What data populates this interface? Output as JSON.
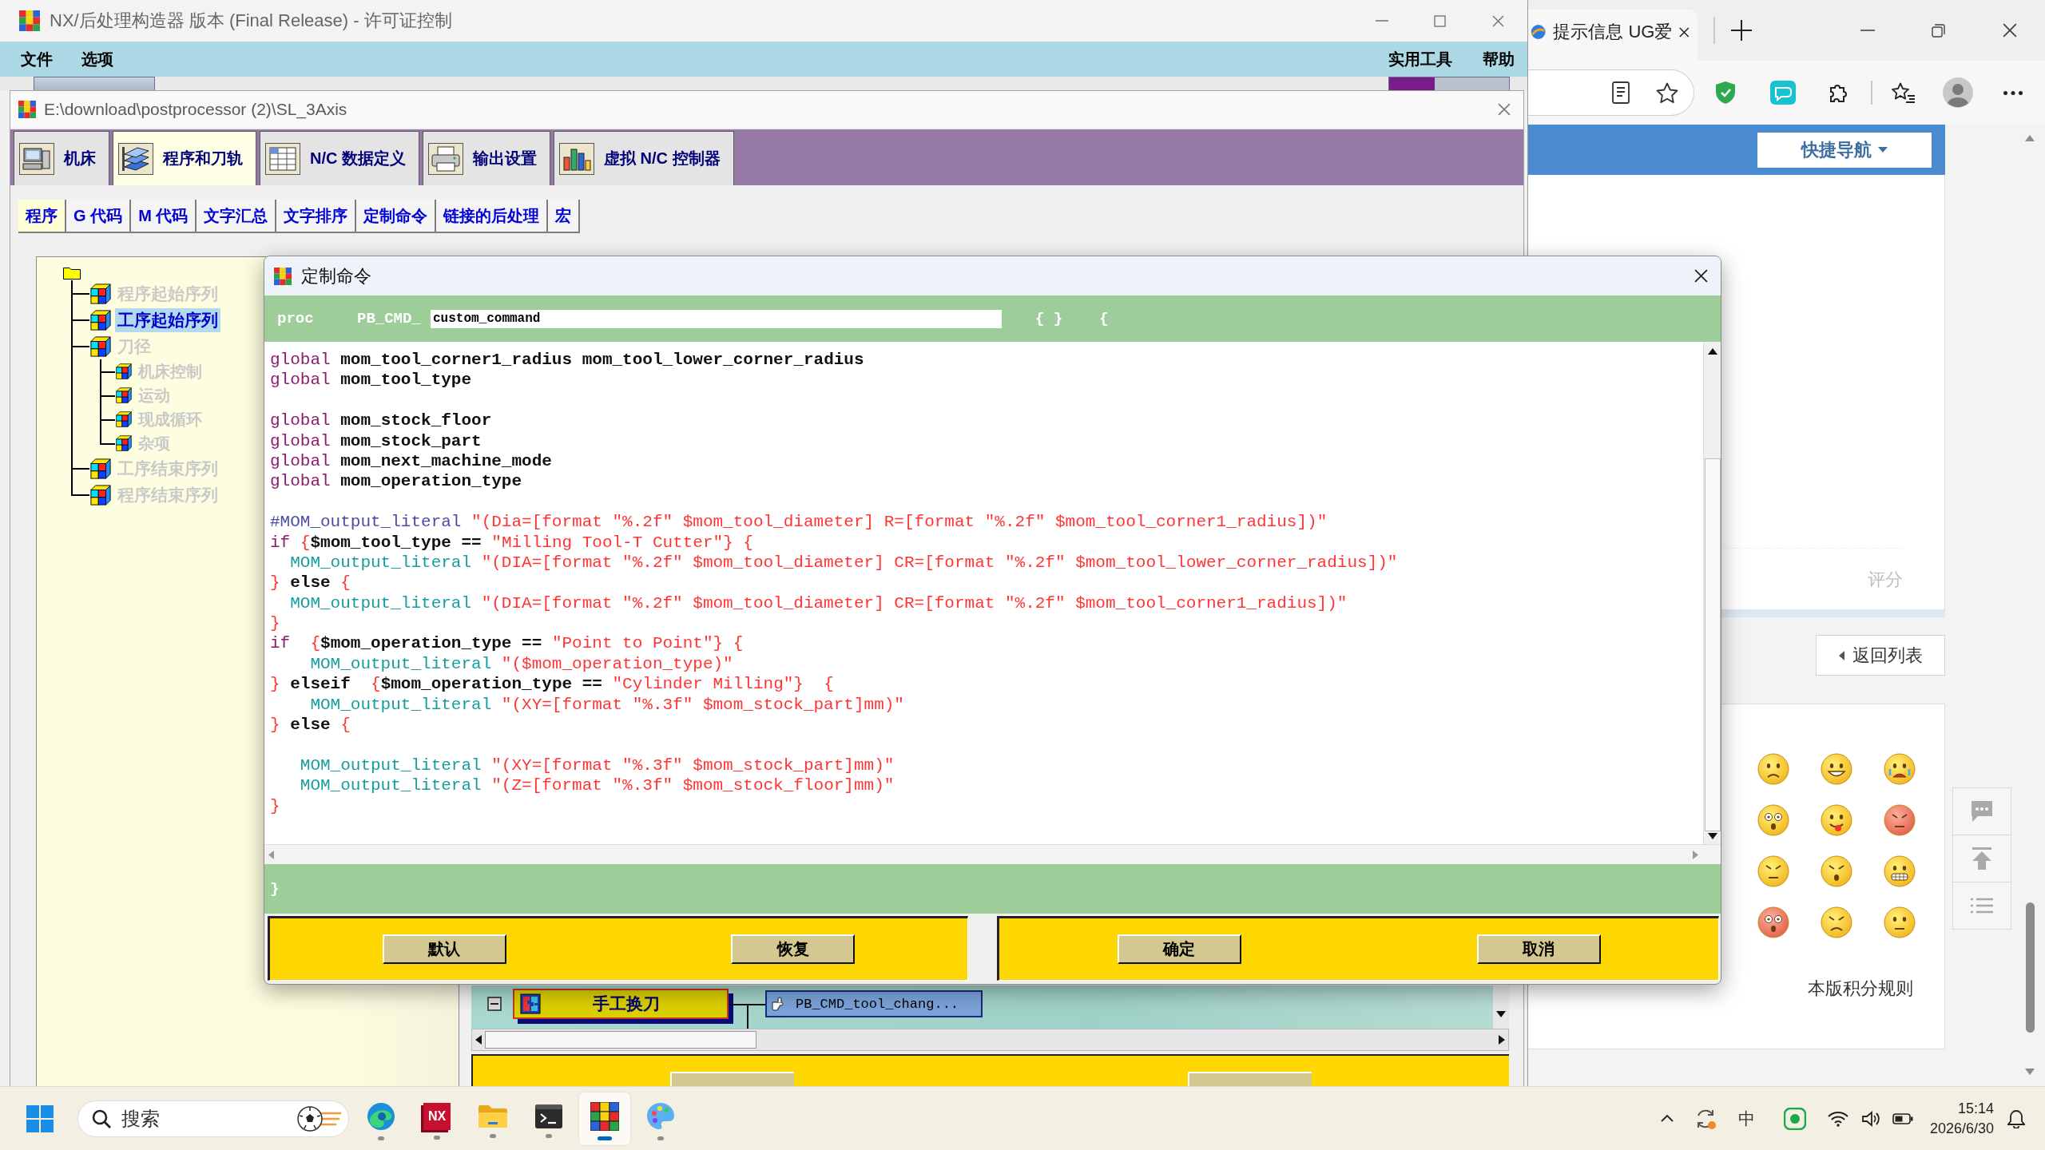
{
  "nx_window": {
    "title": "NX/后处理构造器 版本 (Final Release) - 许可证控制",
    "menu_left": [
      "文件",
      "选项"
    ],
    "menu_right": [
      "实用工具",
      "帮助"
    ]
  },
  "post_window": {
    "title": "E:\\download\\postprocessor (2)\\SL_3Axis",
    "tabs": [
      {
        "label": "机床",
        "kind": "machine",
        "selected": false
      },
      {
        "label": "程序和刀轨",
        "kind": "program",
        "selected": true
      },
      {
        "label": "N/C 数据定义",
        "kind": "data",
        "selected": false
      },
      {
        "label": "输出设置",
        "kind": "output",
        "selected": false
      },
      {
        "label": "虚拟 N/C 控制器",
        "kind": "controller",
        "selected": false
      }
    ],
    "subtabs": [
      {
        "label": "程序",
        "selected": true
      },
      {
        "label": "G 代码",
        "selected": false
      },
      {
        "label": "M 代码",
        "selected": false
      },
      {
        "label": "文字汇总",
        "selected": false
      },
      {
        "label": "文字排序",
        "selected": false
      },
      {
        "label": "定制命令",
        "selected": false
      },
      {
        "label": "链接的后处理",
        "selected": false
      },
      {
        "label": "宏",
        "selected": false
      }
    ],
    "tree": {
      "children": [
        {
          "label": "程序起始序列",
          "selected": false
        },
        {
          "label": "工序起始序列",
          "selected": true
        },
        {
          "label": "刀径",
          "selected": false,
          "children": [
            {
              "label": "机床控制",
              "selected": false
            },
            {
              "label": "运动",
              "selected": false
            },
            {
              "label": "现成循环",
              "selected": false
            },
            {
              "label": "杂项",
              "selected": false
            }
          ]
        },
        {
          "label": "工序结束序列",
          "selected": false
        },
        {
          "label": "程序结束序列",
          "selected": false
        }
      ]
    },
    "sequence": {
      "event": "手工换刀",
      "command": "PB_CMD_tool_chang..."
    }
  },
  "dialog": {
    "title": "定制命令",
    "header": {
      "keyword": "proc",
      "prefix": "PB_CMD_",
      "name_value": "custom_command",
      "args": "{ }",
      "brace": "{"
    },
    "code_lines": [
      {
        "kind": "code",
        "tokens": [
          {
            "kind": "keyword",
            "text": "global"
          },
          {
            "kind": "plain",
            "text": " mom_tool_corner1_radius mom_tool_lower_corner_radius"
          }
        ]
      },
      {
        "kind": "code",
        "tokens": [
          {
            "kind": "keyword",
            "text": "global"
          },
          {
            "kind": "plain",
            "text": " mom_tool_type"
          }
        ]
      },
      {
        "kind": "blank"
      },
      {
        "kind": "code",
        "tokens": [
          {
            "kind": "keyword",
            "text": "global"
          },
          {
            "kind": "plain",
            "text": " mom_stock_floor"
          }
        ]
      },
      {
        "kind": "code",
        "tokens": [
          {
            "kind": "keyword",
            "text": "global"
          },
          {
            "kind": "plain",
            "text": " mom_stock_part"
          }
        ]
      },
      {
        "kind": "code",
        "tokens": [
          {
            "kind": "keyword",
            "text": "global"
          },
          {
            "kind": "plain",
            "text": " mom_next_machine_mode"
          }
        ]
      },
      {
        "kind": "code",
        "tokens": [
          {
            "kind": "keyword",
            "text": "global"
          },
          {
            "kind": "plain",
            "text": " mom_operation_type"
          }
        ]
      },
      {
        "kind": "blank"
      },
      {
        "kind": "code",
        "tokens": [
          {
            "kind": "comment",
            "text": "#MOM_output_literal"
          },
          {
            "kind": "string",
            "text": " \"(Dia=[format \"%.2f\" $mom_tool_diameter] R=[format \"%.2f\" $mom_tool_corner1_radius])\""
          }
        ]
      },
      {
        "kind": "code",
        "tokens": [
          {
            "kind": "keyword",
            "text": "if"
          },
          {
            "kind": "brace",
            "text": " {"
          },
          {
            "kind": "plain",
            "text": "$mom_tool_type =="
          },
          {
            "kind": "string",
            "text": " \"Milling Tool-T Cutter\""
          },
          {
            "kind": "brace",
            "text": "} {"
          }
        ]
      },
      {
        "kind": "code",
        "tokens": [
          {
            "kind": "command",
            "text": "  MOM_output_literal"
          },
          {
            "kind": "string",
            "text": " \"(DIA=[format \"%.2f\" $mom_tool_diameter] CR=[format \"%.2f\" $mom_tool_lower_corner_radius])\""
          }
        ]
      },
      {
        "kind": "code",
        "tokens": [
          {
            "kind": "brace",
            "text": "}"
          },
          {
            "kind": "plain",
            "text": " else"
          },
          {
            "kind": "brace",
            "text": " {"
          }
        ]
      },
      {
        "kind": "code",
        "tokens": [
          {
            "kind": "command",
            "text": "  MOM_output_literal"
          },
          {
            "kind": "string",
            "text": " \"(DIA=[format \"%.2f\" $mom_tool_diameter] CR=[format \"%.2f\" $mom_tool_corner1_radius])\""
          }
        ]
      },
      {
        "kind": "code",
        "tokens": [
          {
            "kind": "brace",
            "text": "}"
          }
        ]
      },
      {
        "kind": "code",
        "tokens": [
          {
            "kind": "keyword",
            "text": "if"
          },
          {
            "kind": "brace",
            "text": "  {"
          },
          {
            "kind": "plain",
            "text": "$mom_operation_type =="
          },
          {
            "kind": "string",
            "text": " \"Point to Point\""
          },
          {
            "kind": "brace",
            "text": "} {"
          }
        ]
      },
      {
        "kind": "code",
        "tokens": [
          {
            "kind": "command",
            "text": "    MOM_output_literal"
          },
          {
            "kind": "string",
            "text": " \"($mom_operation_type)\""
          }
        ]
      },
      {
        "kind": "code",
        "tokens": [
          {
            "kind": "brace",
            "text": "}"
          },
          {
            "kind": "plain",
            "text": " elseif"
          },
          {
            "kind": "brace",
            "text": "  {"
          },
          {
            "kind": "plain",
            "text": "$mom_operation_type =="
          },
          {
            "kind": "string",
            "text": " \"Cylinder Milling\""
          },
          {
            "kind": "brace",
            "text": "}  {"
          }
        ]
      },
      {
        "kind": "code",
        "tokens": [
          {
            "kind": "command",
            "text": "    MOM_output_literal"
          },
          {
            "kind": "string",
            "text": " \"(XY=[format \"%.3f\" $mom_stock_part]mm)\""
          }
        ]
      },
      {
        "kind": "code",
        "tokens": [
          {
            "kind": "brace",
            "text": "}"
          },
          {
            "kind": "plain",
            "text": " else"
          },
          {
            "kind": "brace",
            "text": " {"
          }
        ]
      },
      {
        "kind": "blank"
      },
      {
        "kind": "code",
        "tokens": [
          {
            "kind": "command",
            "text": "   MOM_output_literal"
          },
          {
            "kind": "string",
            "text": " \"(XY=[format \"%.3f\" $mom_stock_part]mm)\""
          }
        ]
      },
      {
        "kind": "code",
        "tokens": [
          {
            "kind": "command",
            "text": "   MOM_output_literal"
          },
          {
            "kind": "string",
            "text": " \"(Z=[format \"%.3f\" $mom_stock_floor]mm)\""
          }
        ]
      },
      {
        "kind": "code",
        "tokens": [
          {
            "kind": "brace",
            "text": "}"
          }
        ]
      }
    ],
    "footer": "}",
    "button_groups": [
      [
        "默认",
        "恢复"
      ],
      [
        "确定",
        "取消"
      ]
    ]
  },
  "browser": {
    "tab_title": "提示信息 UG爱",
    "nav_button": "快捷导航",
    "rating_label": "评分",
    "back_button": "返回列表",
    "rules_link": "本版积分规则"
  },
  "taskbar": {
    "search": {
      "placeholder": "搜索"
    },
    "apps": [
      {
        "kind": "edge",
        "selected": false
      },
      {
        "kind": "nx",
        "label": "NX",
        "selected": false
      },
      {
        "kind": "folder",
        "selected": false
      },
      {
        "kind": "terminal",
        "selected": false
      },
      {
        "kind": "postbuilder",
        "selected": true
      },
      {
        "kind": "paint",
        "selected": false
      }
    ],
    "ime": "中",
    "time": "15:14",
    "date": "2026/6/30"
  }
}
